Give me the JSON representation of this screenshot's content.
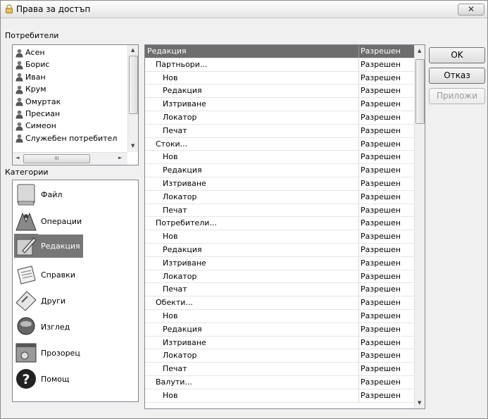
{
  "window": {
    "title": "Права за достъп",
    "close_label": "✕"
  },
  "users_section": {
    "label": "Потребители",
    "items": [
      "Асен",
      "Борис",
      "Иван",
      "Крум",
      "Омуртак",
      "Пресиан",
      "Симеон",
      "Служебен потребител"
    ],
    "hscroll_thumb_glyph": "III"
  },
  "categories_section": {
    "label": "Категории",
    "items": [
      {
        "label": "Файл",
        "icon": "file-icon"
      },
      {
        "label": "Операции",
        "icon": "operations-icon"
      },
      {
        "label": "Редакция",
        "icon": "edit-icon",
        "selected": true
      },
      {
        "label": "Справки",
        "icon": "reports-icon"
      },
      {
        "label": "Други",
        "icon": "other-icon"
      },
      {
        "label": "Изглед",
        "icon": "view-icon"
      },
      {
        "label": "Прозорец",
        "icon": "window-icon"
      },
      {
        "label": "Помощ",
        "icon": "help-icon"
      }
    ]
  },
  "permissions": {
    "header": {
      "name": "Редакция",
      "value": "Разрешен"
    },
    "rows": [
      {
        "name": "Партньори...",
        "value": "Разрешен",
        "level": 1
      },
      {
        "name": "Нов",
        "value": "Разрешен",
        "level": 2
      },
      {
        "name": "Редакция",
        "value": "Разрешен",
        "level": 2
      },
      {
        "name": "Изтриване",
        "value": "Разрешен",
        "level": 2
      },
      {
        "name": "Локатор",
        "value": "Разрешен",
        "level": 2
      },
      {
        "name": "Печат",
        "value": "Разрешен",
        "level": 2
      },
      {
        "name": "Стоки...",
        "value": "Разрешен",
        "level": 1
      },
      {
        "name": "Нов",
        "value": "Разрешен",
        "level": 2
      },
      {
        "name": "Редакция",
        "value": "Разрешен",
        "level": 2
      },
      {
        "name": "Изтриване",
        "value": "Разрешен",
        "level": 2
      },
      {
        "name": "Локатор",
        "value": "Разрешен",
        "level": 2
      },
      {
        "name": "Печат",
        "value": "Разрешен",
        "level": 2
      },
      {
        "name": "Потребители...",
        "value": "Разрешен",
        "level": 1
      },
      {
        "name": "Нов",
        "value": "Разрешен",
        "level": 2
      },
      {
        "name": "Редакция",
        "value": "Разрешен",
        "level": 2
      },
      {
        "name": "Изтриване",
        "value": "Разрешен",
        "level": 2
      },
      {
        "name": "Локатор",
        "value": "Разрешен",
        "level": 2
      },
      {
        "name": "Печат",
        "value": "Разрешен",
        "level": 2
      },
      {
        "name": "Обекти...",
        "value": "Разрешен",
        "level": 1
      },
      {
        "name": "Нов",
        "value": "Разрешен",
        "level": 2
      },
      {
        "name": "Редакция",
        "value": "Разрешен",
        "level": 2
      },
      {
        "name": "Изтриване",
        "value": "Разрешен",
        "level": 2
      },
      {
        "name": "Локатор",
        "value": "Разрешен",
        "level": 2
      },
      {
        "name": "Печат",
        "value": "Разрешен",
        "level": 2
      },
      {
        "name": "Валути...",
        "value": "Разрешен",
        "level": 1
      },
      {
        "name": "Нов",
        "value": "Разрешен",
        "level": 2
      }
    ]
  },
  "buttons": {
    "ok": "OK",
    "cancel": "Отказ",
    "apply": "Приложи"
  }
}
